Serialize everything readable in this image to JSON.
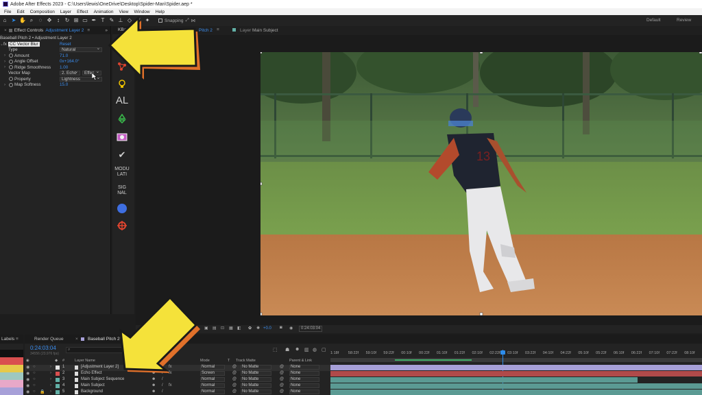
{
  "title_bar": {
    "text": "Adobe After Effects 2023 - C:\\Users\\lewis\\OneDrive\\Desktop\\Spider-Man\\Spider.aep *"
  },
  "menu": [
    "File",
    "Edit",
    "Composition",
    "Layer",
    "Effect",
    "Animation",
    "View",
    "Window",
    "Help"
  ],
  "toolbar": {
    "snapping_label": "Snapping",
    "workspaces": [
      "Default",
      "Review"
    ]
  },
  "effect_controls": {
    "tab_label": "Effect Controls",
    "tab_target": "Adjustment Layer 2",
    "breadcrumb": "Baseball Pitch 2 • Adjustment Layer 2",
    "effect_name": "CC Vector Blur",
    "reset": "Reset",
    "props": [
      {
        "label": "Type",
        "value": "Natural",
        "kind": "dropdown"
      },
      {
        "label": "Amount",
        "value": "71.0",
        "kind": "value"
      },
      {
        "label": "Angle Offset",
        "value": "0x+164.0°",
        "kind": "value"
      },
      {
        "label": "Ridge Smoothness",
        "value": "1.00",
        "kind": "value"
      },
      {
        "label": "Vector Map",
        "value": "2. Echo",
        "value2": "Effec",
        "kind": "dual"
      },
      {
        "label": "Property",
        "value": "Lightness",
        "kind": "dropdown"
      },
      {
        "label": "Map Softness",
        "value": "15.0",
        "kind": "value"
      }
    ]
  },
  "plugin_strip": {
    "tab": "KBa",
    "al": "AL",
    "modulation": "MODU\nLATI",
    "signal": "SIG\nNAL"
  },
  "viewer": {
    "comp_tab": "Pitch 2",
    "layer_tab_prefix": "Layer",
    "layer_tab_name": "Main Subject",
    "timecode": "0:24:03:04",
    "exposure": "+0.0"
  },
  "timeline": {
    "labels_tab": "Labels",
    "render_queue_tab": "Render Queue",
    "comp_tab": "Baseball Pitch 2",
    "timecode": "0:24:03:04",
    "timecode_sub": "34556 (23.976 fps)",
    "search_placeholder": "",
    "headers": {
      "layer_name": "Layer Name",
      "mode": "Mode",
      "track_matte": "Track Matte",
      "parent": "Parent & Link",
      "t": "T"
    },
    "layers": [
      {
        "num": "1",
        "name": "[Adjustment Layer 2]",
        "mode": "Normal",
        "matte": "No Matte",
        "parent": "None",
        "color": "#e6e6e6"
      },
      {
        "num": "2",
        "name": "Echo Effect",
        "mode": "Screen",
        "matte": "No Matte",
        "parent": "None",
        "color": "#d94f4f"
      },
      {
        "num": "3",
        "name": "Main Subject Sequence",
        "mode": "Normal",
        "matte": "No Matte",
        "parent": "None",
        "color": "#62b0a6"
      },
      {
        "num": "4",
        "name": "Main Subject",
        "mode": "Normal",
        "matte": "No Matte",
        "parent": "None",
        "color": "#62b0a6"
      },
      {
        "num": "5",
        "name": "Background",
        "mode": "Normal",
        "matte": "No Matte",
        "parent": "None",
        "color": "#62b0a6"
      }
    ],
    "ruler": [
      "1:18f",
      "58:22f",
      "59:10f",
      "59:22f",
      "00:10f",
      "00:22f",
      "01:10f",
      "01:22f",
      "02:10f",
      "02:22f",
      "03:10f",
      "03:22f",
      "04:10f",
      "04:22f",
      "05:10f",
      "05:22f",
      "06:10f",
      "06:22f",
      "07:10f",
      "07:22f",
      "08:10f"
    ]
  },
  "colors": {
    "accent": "#2d8ceb",
    "arrow_yellow": "#f5e23a",
    "arrow_orange": "#e0702a",
    "panel": "#232323",
    "bg": "#1d1d1d"
  }
}
